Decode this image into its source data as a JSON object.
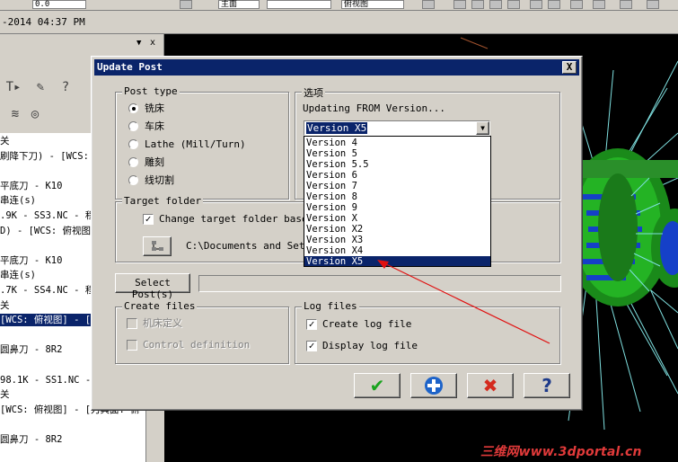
{
  "toolbar": {
    "field1": "0.0",
    "field2": "主面",
    "field3": "俯视图"
  },
  "datebar": {
    "text": "-2014 04:37 PM"
  },
  "left_panel": {
    "rows": [
      "关",
      "刷降下刀) - [WCS:",
      "",
      "平底刀 - K10",
      "串连(s)",
      ".9K - SS3.NC - 程",
      "D) - [WCS: 俯视图",
      "",
      "平底刀 - K10",
      "串连(s)",
      ".7K - SS4.NC - 程",
      "关",
      "[WCS: 俯视图] - [",
      "",
      "圆鼻刀 - 8R2",
      "",
      "98.1K - SS1.NC -",
      "关",
      "[WCS: 俯视图] - [刀具面: 俯",
      "",
      "圆鼻刀 - 8R2"
    ],
    "selected_row": 12
  },
  "watermark": "三维网www.3dportal.cn",
  "dialog": {
    "title": "Update Post",
    "close_glyph": "X",
    "post_type": {
      "legend": "Post type",
      "options": [
        "铣床",
        "车床",
        "Lathe (Mill/Turn)",
        "雕刻",
        "线切割"
      ],
      "selected": 0
    },
    "options_group": {
      "legend": "选项",
      "updating_label": "Updating FROM Version...",
      "combo_value": "Version X5",
      "dropdown_options": [
        "Version 4",
        "Version 5",
        "Version 5.5",
        "Version 6",
        "Version 7",
        "Version 8",
        "Version 9",
        "Version X",
        "Version X2",
        "Version X3",
        "Version X4",
        "Version X5"
      ],
      "dropdown_selected": 11
    },
    "target_folder": {
      "legend": "Target folder",
      "change_label": "Change target folder based",
      "change_checked": true,
      "path": "C:\\Documents and Setti"
    },
    "select_post": {
      "label": "Select Post(s)",
      "path": ""
    },
    "create_files": {
      "legend": "Create files",
      "items": [
        {
          "label": "机床定义",
          "checked": false,
          "enabled": false
        },
        {
          "label": "Control definition",
          "checked": false,
          "enabled": false
        }
      ]
    },
    "log_files": {
      "legend": "Log files",
      "items": [
        {
          "label": "Create log file",
          "checked": true
        },
        {
          "label": "Display log file",
          "checked": true
        }
      ]
    },
    "buttons": {
      "ok_glyph": "✔",
      "add_glyph": "+",
      "cancel_glyph": "✖",
      "help_glyph": "?"
    }
  },
  "colors": {
    "titlebar": "#0a246a",
    "face": "#d4d0c8",
    "selection": "#0a246a",
    "ok": "#19a31e",
    "add": "#1d63c9",
    "cancel": "#d42a1e",
    "help": "#1d3a8a"
  }
}
